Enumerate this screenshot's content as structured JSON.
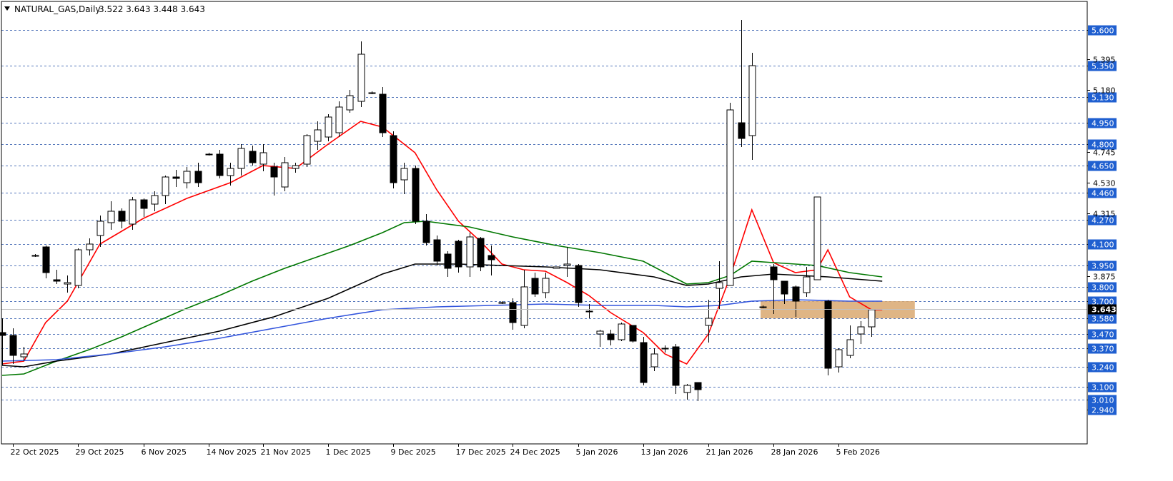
{
  "header": {
    "symbol": "NATURAL_GAS,Daily",
    "ohlc": "3.522 3.643 3.448 3.643"
  },
  "chart_data": {
    "type": "candlestick",
    "ylim": [
      2.94,
      5.75
    ],
    "grid": true,
    "y_ticks_plain": [
      "5.395",
      "5.180",
      "4.745",
      "4.530",
      "4.315",
      "3.875"
    ],
    "y_ticks_tagged": [
      "5.600",
      "5.350",
      "5.130",
      "4.950",
      "4.800",
      "4.650",
      "4.460",
      "4.270",
      "4.100",
      "3.950",
      "3.800",
      "3.700",
      "3.580",
      "3.470",
      "3.370",
      "3.240",
      "3.100",
      "3.010",
      "2.940"
    ],
    "current_price": "3.643",
    "x_labels": [
      {
        "text": "22 Oct 2025",
        "index": 1
      },
      {
        "text": "29 Oct 2025",
        "index": 7
      },
      {
        "text": "6 Nov 2025",
        "index": 13
      },
      {
        "text": "14 Nov 2025",
        "index": 19
      },
      {
        "text": "21 Nov 2025",
        "index": 24
      },
      {
        "text": "1 Dec 2025",
        "index": 30
      },
      {
        "text": "9 Dec 2025",
        "index": 36
      },
      {
        "text": "17 Dec 2025",
        "index": 42
      },
      {
        "text": "24 Dec 2025",
        "index": 47
      },
      {
        "text": "5 Jan 2026",
        "index": 53
      },
      {
        "text": "13 Jan 2026",
        "index": 59
      },
      {
        "text": "21 Jan 2026",
        "index": 65
      },
      {
        "text": "28 Jan 2026",
        "index": 71
      },
      {
        "text": "5 Feb 2026",
        "index": 77
      }
    ],
    "candles": [
      [
        3.48,
        3.46,
        3.58,
        3.25
      ],
      [
        3.46,
        3.32,
        3.51,
        3.26
      ],
      [
        3.31,
        3.33,
        3.38,
        3.28
      ],
      [
        4.02,
        4.02,
        4.03,
        4.01
      ],
      [
        4.08,
        3.9,
        4.09,
        3.86
      ],
      [
        3.85,
        3.84,
        3.92,
        3.82
      ],
      [
        3.82,
        3.83,
        3.88,
        3.76
      ],
      [
        3.81,
        4.06,
        4.07,
        3.79
      ],
      [
        4.06,
        4.1,
        4.14,
        4.02
      ],
      [
        4.16,
        4.26,
        4.3,
        4.08
      ],
      [
        4.25,
        4.33,
        4.4,
        4.2
      ],
      [
        4.33,
        4.26,
        4.35,
        4.21
      ],
      [
        4.24,
        4.41,
        4.43,
        4.2
      ],
      [
        4.41,
        4.35,
        4.42,
        4.29
      ],
      [
        4.38,
        4.44,
        4.47,
        4.33
      ],
      [
        4.44,
        4.57,
        4.58,
        4.38
      ],
      [
        4.57,
        4.56,
        4.62,
        4.5
      ],
      [
        4.53,
        4.61,
        4.64,
        4.49
      ],
      [
        4.61,
        4.53,
        4.67,
        4.5
      ],
      [
        4.73,
        4.73,
        4.74,
        4.72
      ],
      [
        4.73,
        4.58,
        4.76,
        4.56
      ],
      [
        4.58,
        4.63,
        4.67,
        4.51
      ],
      [
        4.63,
        4.77,
        4.8,
        4.58
      ],
      [
        4.75,
        4.67,
        4.79,
        4.65
      ],
      [
        4.66,
        4.74,
        4.8,
        4.61
      ],
      [
        4.64,
        4.57,
        4.67,
        4.44
      ],
      [
        4.5,
        4.67,
        4.71,
        4.47
      ],
      [
        4.63,
        4.65,
        4.67,
        4.6
      ],
      [
        4.66,
        4.86,
        4.87,
        4.64
      ],
      [
        4.82,
        4.9,
        4.96,
        4.76
      ],
      [
        4.85,
        4.99,
        5.01,
        4.82
      ],
      [
        4.88,
        5.06,
        5.1,
        4.85
      ],
      [
        5.04,
        5.14,
        5.18,
        5.02
      ],
      [
        5.1,
        5.43,
        5.52,
        5.06
      ],
      [
        5.16,
        5.16,
        5.17,
        5.15
      ],
      [
        5.15,
        4.88,
        5.2,
        4.85
      ],
      [
        4.86,
        4.53,
        4.89,
        4.49
      ],
      [
        4.55,
        4.63,
        4.67,
        4.45
      ],
      [
        4.63,
        4.26,
        4.65,
        4.24
      ],
      [
        4.26,
        4.11,
        4.31,
        4.09
      ],
      [
        4.13,
        3.98,
        4.16,
        3.95
      ],
      [
        4.03,
        3.93,
        4.05,
        3.87
      ],
      [
        4.12,
        3.94,
        4.13,
        3.9
      ],
      [
        3.94,
        4.15,
        4.18,
        3.87
      ],
      [
        4.14,
        3.94,
        4.15,
        3.91
      ],
      [
        4.02,
        3.99,
        4.09,
        3.88
      ],
      [
        3.69,
        3.69,
        3.7,
        3.68
      ],
      [
        3.69,
        3.55,
        3.72,
        3.5
      ],
      [
        3.53,
        3.8,
        3.92,
        3.51
      ],
      [
        3.86,
        3.75,
        3.9,
        3.73
      ],
      [
        3.76,
        3.86,
        3.9,
        3.72
      ],
      [
        3.93,
        3.94,
        3.94,
        3.93
      ],
      [
        3.95,
        3.96,
        4.08,
        3.87
      ],
      [
        3.95,
        3.69,
        3.96,
        3.66
      ],
      [
        3.63,
        3.63,
        3.68,
        3.58
      ],
      [
        3.47,
        3.49,
        3.5,
        3.38
      ],
      [
        3.47,
        3.43,
        3.5,
        3.39
      ],
      [
        3.43,
        3.54,
        3.55,
        3.42
      ],
      [
        3.53,
        3.42,
        3.53,
        3.41
      ],
      [
        3.41,
        3.13,
        3.45,
        3.11
      ],
      [
        3.24,
        3.33,
        3.37,
        3.21
      ],
      [
        3.37,
        3.37,
        3.39,
        3.34
      ],
      [
        3.38,
        3.11,
        3.4,
        3.05
      ],
      [
        3.06,
        3.11,
        3.12,
        3.01
      ],
      [
        3.13,
        3.08,
        3.13,
        3.0
      ],
      [
        3.53,
        3.58,
        3.71,
        3.41
      ],
      [
        3.79,
        3.83,
        3.98,
        3.64
      ],
      [
        3.81,
        5.04,
        5.09,
        3.81
      ],
      [
        4.95,
        4.84,
        5.67,
        4.78
      ],
      [
        4.86,
        5.35,
        5.44,
        4.69
      ],
      [
        3.66,
        3.66,
        3.67,
        3.65
      ],
      [
        3.94,
        3.85,
        3.96,
        3.61
      ],
      [
        3.84,
        3.75,
        3.84,
        3.68
      ],
      [
        3.8,
        3.7,
        3.81,
        3.59
      ],
      [
        3.76,
        3.87,
        3.94,
        3.73
      ],
      [
        3.85,
        4.43,
        4.43,
        3.85
      ],
      [
        3.7,
        3.23,
        3.71,
        3.18
      ],
      [
        3.24,
        3.36,
        3.37,
        3.2
      ],
      [
        3.32,
        3.43,
        3.53,
        3.3
      ],
      [
        3.47,
        3.52,
        3.56,
        3.4
      ],
      [
        3.52,
        3.64,
        3.64,
        3.45
      ]
    ],
    "moving_averages": [
      {
        "color": "#ff0000",
        "points": [
          [
            0,
            3.26
          ],
          [
            2,
            3.28
          ],
          [
            4,
            3.55
          ],
          [
            6,
            3.7
          ],
          [
            9,
            4.1
          ],
          [
            13,
            4.28
          ],
          [
            17,
            4.42
          ],
          [
            21,
            4.53
          ],
          [
            24,
            4.65
          ],
          [
            27,
            4.63
          ],
          [
            30,
            4.8
          ],
          [
            33,
            4.96
          ],
          [
            35,
            4.92
          ],
          [
            38,
            4.74
          ],
          [
            40,
            4.48
          ],
          [
            42,
            4.26
          ],
          [
            44,
            4.12
          ],
          [
            46,
            3.96
          ],
          [
            48,
            3.92
          ],
          [
            50,
            3.91
          ],
          [
            52,
            3.83
          ],
          [
            54,
            3.74
          ],
          [
            56,
            3.62
          ],
          [
            59,
            3.48
          ],
          [
            61,
            3.33
          ],
          [
            63,
            3.26
          ],
          [
            65,
            3.47
          ],
          [
            67,
            3.87
          ],
          [
            69,
            4.34
          ],
          [
            71,
            3.97
          ],
          [
            73,
            3.9
          ],
          [
            75,
            3.92
          ],
          [
            76,
            4.06
          ],
          [
            78,
            3.73
          ],
          [
            80,
            3.64
          ],
          [
            81,
            3.64
          ]
        ]
      },
      {
        "color": "#007700",
        "points": [
          [
            0,
            3.18
          ],
          [
            2,
            3.19
          ],
          [
            5,
            3.28
          ],
          [
            8,
            3.36
          ],
          [
            11,
            3.45
          ],
          [
            14,
            3.55
          ],
          [
            17,
            3.65
          ],
          [
            20,
            3.74
          ],
          [
            23,
            3.84
          ],
          [
            26,
            3.93
          ],
          [
            29,
            4.01
          ],
          [
            32,
            4.09
          ],
          [
            35,
            4.18
          ],
          [
            37,
            4.25
          ],
          [
            39,
            4.26
          ],
          [
            43,
            4.22
          ],
          [
            47,
            4.15
          ],
          [
            51,
            4.09
          ],
          [
            55,
            4.04
          ],
          [
            59,
            3.98
          ],
          [
            63,
            3.82
          ],
          [
            65,
            3.83
          ],
          [
            67,
            3.88
          ],
          [
            69,
            3.98
          ],
          [
            71,
            3.97
          ],
          [
            75,
            3.95
          ],
          [
            78,
            3.9
          ],
          [
            81,
            3.87
          ]
        ]
      },
      {
        "color": "#000000",
        "points": [
          [
            0,
            3.25
          ],
          [
            2,
            3.24
          ],
          [
            5,
            3.28
          ],
          [
            10,
            3.33
          ],
          [
            15,
            3.41
          ],
          [
            20,
            3.49
          ],
          [
            25,
            3.59
          ],
          [
            30,
            3.72
          ],
          [
            35,
            3.89
          ],
          [
            38,
            3.96
          ],
          [
            42,
            3.96
          ],
          [
            46,
            3.95
          ],
          [
            50,
            3.94
          ],
          [
            55,
            3.92
          ],
          [
            60,
            3.87
          ],
          [
            63,
            3.81
          ],
          [
            65,
            3.82
          ],
          [
            68,
            3.87
          ],
          [
            71,
            3.89
          ],
          [
            76,
            3.87
          ],
          [
            81,
            3.84
          ]
        ]
      },
      {
        "color": "#3355dd",
        "points": [
          [
            0,
            3.28
          ],
          [
            5,
            3.29
          ],
          [
            10,
            3.33
          ],
          [
            15,
            3.38
          ],
          [
            20,
            3.44
          ],
          [
            25,
            3.51
          ],
          [
            30,
            3.58
          ],
          [
            35,
            3.64
          ],
          [
            40,
            3.66
          ],
          [
            45,
            3.67
          ],
          [
            50,
            3.68
          ],
          [
            55,
            3.67
          ],
          [
            60,
            3.67
          ],
          [
            63,
            3.66
          ],
          [
            66,
            3.67
          ],
          [
            69,
            3.7
          ],
          [
            73,
            3.71
          ],
          [
            78,
            3.7
          ],
          [
            81,
            3.7
          ]
        ]
      }
    ],
    "shaded_zone": {
      "from_index": 70,
      "to_index": 84,
      "low": 3.58,
      "high": 3.7,
      "color": "#d9a870"
    }
  }
}
